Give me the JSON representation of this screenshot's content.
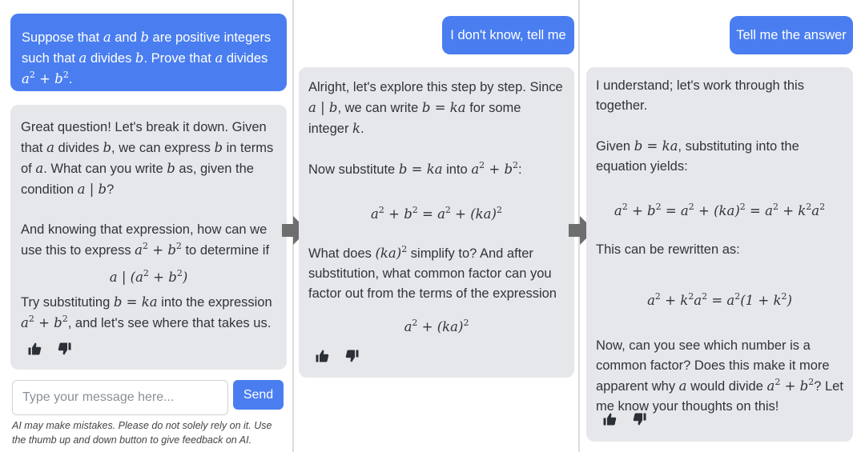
{
  "col1": {
    "user_msg": {
      "t1": "Suppose that ",
      "m1": "a",
      "t2": " and ",
      "m2": "b",
      "t3": " are positive integers such that ",
      "m3": "a",
      "t4": " divides ",
      "m4": "b",
      "t5": ". Prove that ",
      "m5": "a",
      "t6": " divides ",
      "m6": "a",
      "m7": " + b",
      "t7": "."
    },
    "ai_msg": {
      "p1_t1": "Great question! Let's break it down. Given that ",
      "p1_m1": "a",
      "p1_t2": " divides ",
      "p1_m2": "b",
      "p1_t3": ", we can express ",
      "p1_m3": "b",
      "p1_t4": " in terms of ",
      "p1_m4": "a",
      "p1_t5": ". What can you write ",
      "p1_m5": "b",
      "p1_t6": " as, given the condition ",
      "p1_m6": "a | b",
      "p1_t7": "?",
      "p2_t1": "And knowing that expression, how can we use this to express ",
      "p2_m1": "a",
      "p2_m2": " + b",
      "p2_t2": " to determine if",
      "eq1_a": "a | (a",
      "eq1_b": " + b",
      "eq1_c": ")",
      "p3_t1": "Try substituting ",
      "p3_m1": "b = ka",
      "p3_t2": " into the expression ",
      "p3_m2": "a",
      "p3_m3": " + b",
      "p3_t3": ", and let's see where that takes us."
    }
  },
  "col2": {
    "user_msg": "I don't know, tell me",
    "ai_msg": {
      "p1_t1": "Alright, let's explore this step by step. Since ",
      "p1_m1": "a | b",
      "p1_t2": ", we can write ",
      "p1_m2": "b = ka",
      "p1_t3": " for some integer ",
      "p1_m3": "k",
      "p1_t4": ".",
      "p2_t1": "Now substitute ",
      "p2_m1": "b = ka",
      "p2_t2": " into ",
      "p2_m2": "a",
      "p2_m3": " + b",
      "p2_t3": ":",
      "eq1_a": "a",
      "eq1_b": " + b",
      "eq1_c": " = a",
      "eq1_d": " + (ka)",
      "p3_t1": "What does ",
      "p3_m1": "(ka)",
      "p3_t2": " simplify to? And after substitution, what common factor can you factor out from the terms of the expression",
      "eq2_a": "a",
      "eq2_b": " + (ka)"
    }
  },
  "col3": {
    "user_msg": "Tell me the answer",
    "ai_msg": {
      "p1": "I understand; let's work through this together.",
      "p2_t1": "Given ",
      "p2_m1": "b = ka",
      "p2_t2": ", substituting into the equation yields:",
      "eq1_a": "a",
      "eq1_b": " + b",
      "eq1_c": " = a",
      "eq1_d": " + (ka)",
      "eq1_e": " = a",
      "eq1_f": " + k",
      "eq1_g": "a",
      "p3": "This can be rewritten as:",
      "eq2_a": "a",
      "eq2_b": " + k",
      "eq2_c": "a",
      "eq2_d": " = a",
      "eq2_e": "(1 + k",
      "eq2_f": ")",
      "p4_t1": "Now, can you see which number is a common factor? Does this make it more apparent why ",
      "p4_m1": "a",
      "p4_t2": " would divide ",
      "p4_m2": "a",
      "p4_m3": " + b",
      "p4_t3": "? Let me know your thoughts on this!"
    }
  },
  "sup2": "2",
  "input": {
    "placeholder": "Type your message here..."
  },
  "send_label": "Send",
  "disclaimer": "AI may make mistakes. Please do not solely rely on it. Use the thumb up and down button to give feedback on AI.",
  "icons": {
    "like": "thumbs-up-icon",
    "dislike": "thumbs-down-icon",
    "arrow": "arrow-right-icon"
  },
  "colors": {
    "user_bubble": "#4a7ef0",
    "ai_bubble": "#e6e7eb",
    "arrow": "#6e6e6e"
  }
}
